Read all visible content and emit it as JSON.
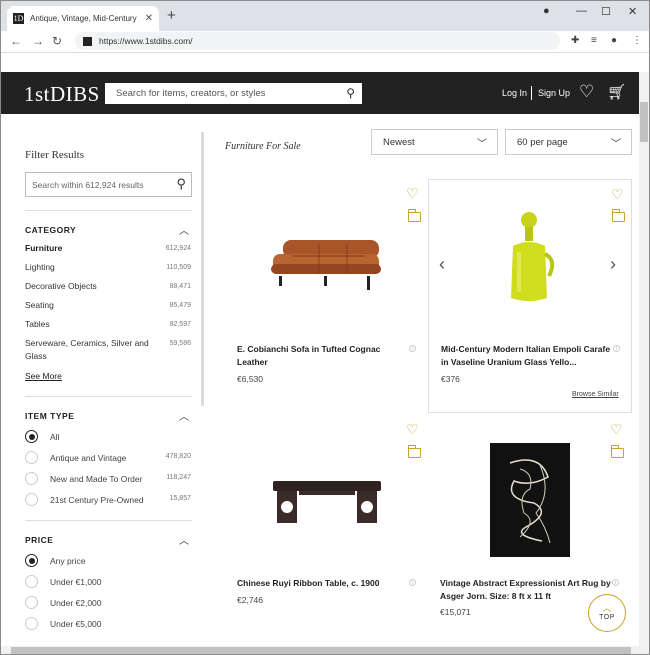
{
  "browser": {
    "tab_title": "Antique, Vintage, Mid-Century a",
    "tab_close": "✕",
    "new_tab": "+",
    "url": "https://www.1stdibs.com/",
    "favicon_text": "1D"
  },
  "header": {
    "logo": "1stDIBS",
    "search_placeholder": "Search for items, creators, or styles",
    "login": "Log In",
    "signup": "Sign Up"
  },
  "sidebar": {
    "title": "Filter Results",
    "search_placeholder": "Search within 612,924 results",
    "category": {
      "heading": "CATEGORY",
      "items": [
        {
          "label": "Furniture",
          "count": "612,924"
        },
        {
          "label": "Lighting",
          "count": "110,509"
        },
        {
          "label": "Decorative Objects",
          "count": "88,471"
        },
        {
          "label": "Seating",
          "count": "85,479"
        },
        {
          "label": "Tables",
          "count": "82,597"
        },
        {
          "label": "Serveware, Ceramics, Silver and Glass",
          "count": "59,586"
        }
      ],
      "see_more": "See More"
    },
    "item_type": {
      "heading": "ITEM TYPE",
      "options": [
        {
          "label": "All",
          "count": ""
        },
        {
          "label": "Antique and Vintage",
          "count": "478,820"
        },
        {
          "label": "New and Made To Order",
          "count": "118,247"
        },
        {
          "label": "21st Century Pre-Owned",
          "count": "15,857"
        }
      ]
    },
    "price": {
      "heading": "PRICE",
      "options": [
        {
          "label": "Any price"
        },
        {
          "label": "Under €1,000"
        },
        {
          "label": "Under €2,000"
        },
        {
          "label": "Under €5,000"
        }
      ]
    }
  },
  "main": {
    "title": "Furniture For Sale",
    "sort": "Newest",
    "per_page": "60 per page",
    "products": [
      {
        "name": "E. Cobianchi Sofa in Tufted Cognac Leather",
        "price": "€6,530"
      },
      {
        "name": "Mid-Century Modern Italian Empoli Carafe in Vaseline Uranium Glass Yello...",
        "price": "€376",
        "browse": "Browse Similar"
      },
      {
        "name": "Chinese Ruyi Ribbon Table, c. 1900",
        "price": "€2,746"
      },
      {
        "name": "Vintage Abstract Expressionist Art Rug by Asger Jorn. Size: 8 ft x 11 ft",
        "price": "€15,071"
      }
    ],
    "top_label": "TOP"
  },
  "colors": {
    "accent": "#c9a227",
    "header_bg": "#222222"
  }
}
